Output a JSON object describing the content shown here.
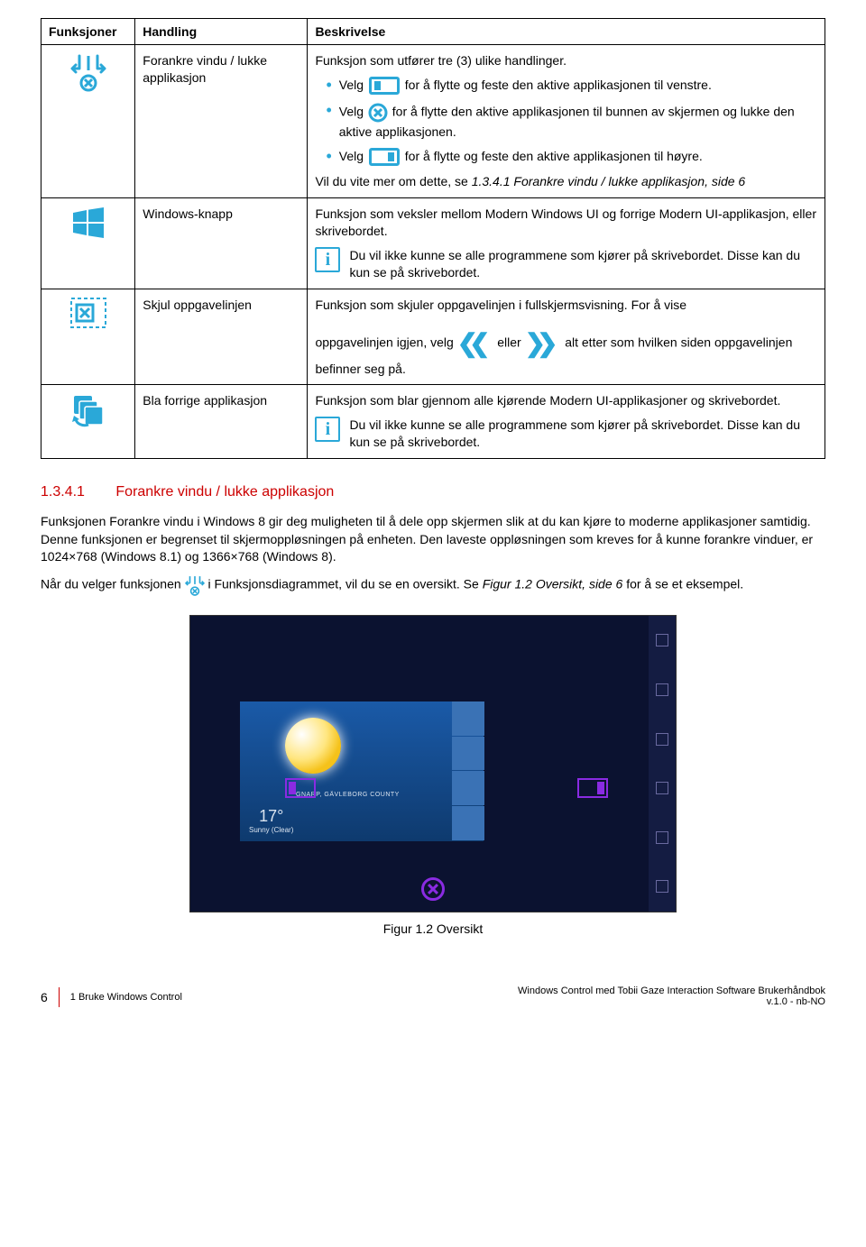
{
  "table": {
    "headers": {
      "func": "Funksjoner",
      "handling": "Handling",
      "desc": "Beskrivelse"
    },
    "rows": {
      "r1": {
        "handling": "Forankre vindu / lukke applikasjon",
        "desc_intro": "Funksjon som utfører tre (3) ulike handlinger.",
        "b1a": "Velg ",
        "b1b": "for å flytte og feste den aktive applikasjonen til venstre.",
        "b2a": "Velg ",
        "b2b": "for å flytte den aktive applikasjonen til bunnen av skjermen og lukke den aktive applikasjonen.",
        "b3a": "Velg ",
        "b3b": "for å flytte og feste den aktive applikasjonen til høyre.",
        "more1": "Vil du vite mer om dette, se ",
        "more_ref": "1.3.4.1 Forankre vindu / lukke applikasjon, side 6"
      },
      "r2": {
        "handling": "Windows-knapp",
        "desc": "Funksjon som veksler mellom Modern Windows UI og forrige Modern UI-applikasjon, eller skrivebordet.",
        "info": "Du vil ikke kunne se alle programmene som kjører på skrivebordet. Disse kan du kun se på skrivebordet."
      },
      "r3": {
        "handling": "Skjul oppgavelinjen",
        "desc1": "Funksjon som skjuler oppgavelinjen i fullskjermsvisning. For å vise",
        "desc2a": "oppgavelinjen igjen, velg ",
        "desc2b": "eller ",
        "desc2c": "alt etter som hvilken siden oppgavelinjen befinner seg på."
      },
      "r4": {
        "handling": "Bla forrige applikasjon",
        "desc": "Funksjon som blar gjennom alle kjørende Modern UI-applikasjoner og skrivebordet.",
        "info": "Du vil ikke kunne se alle programmene som kjører på skrivebordet. Disse kan du kun se på skrivebordet."
      }
    }
  },
  "section": {
    "num": "1.3.4.1",
    "title": "Forankre vindu / lukke applikasjon",
    "p1": "Funksjonen Forankre vindu i Windows 8 gir deg muligheten til å dele opp skjermen slik at du kan kjøre to moderne applikasjoner samtidig. Denne funksjonen er begrenset til skjermoppløsningen på enheten. Den laveste oppløsningen som kreves for å kunne forankre vinduer, er 1024×768 (Windows 8.1) og 1366×768 (Windows 8).",
    "p2a": "Når du velger funksjonen ",
    "p2b": " i Funksjonsdiagrammet, vil du se en oversikt. Se ",
    "p2ref": "Figur 1.2 Oversikt, side 6",
    "p2c": " for å se et eksempel."
  },
  "figure": {
    "label": "Figur 1.2",
    "title": "Oversikt",
    "tile_top": "GNARP, GÄVLEBORG COUNTY",
    "tile_deg": "17°",
    "tile_cond": "Sunny (Clear)"
  },
  "footer": {
    "page": "6",
    "chapter": "1 Bruke Windows Control",
    "doc": "Windows Control med Tobii Gaze Interaction Software Brukerhåndbok",
    "ver": "v.1.0 - nb-NO"
  }
}
